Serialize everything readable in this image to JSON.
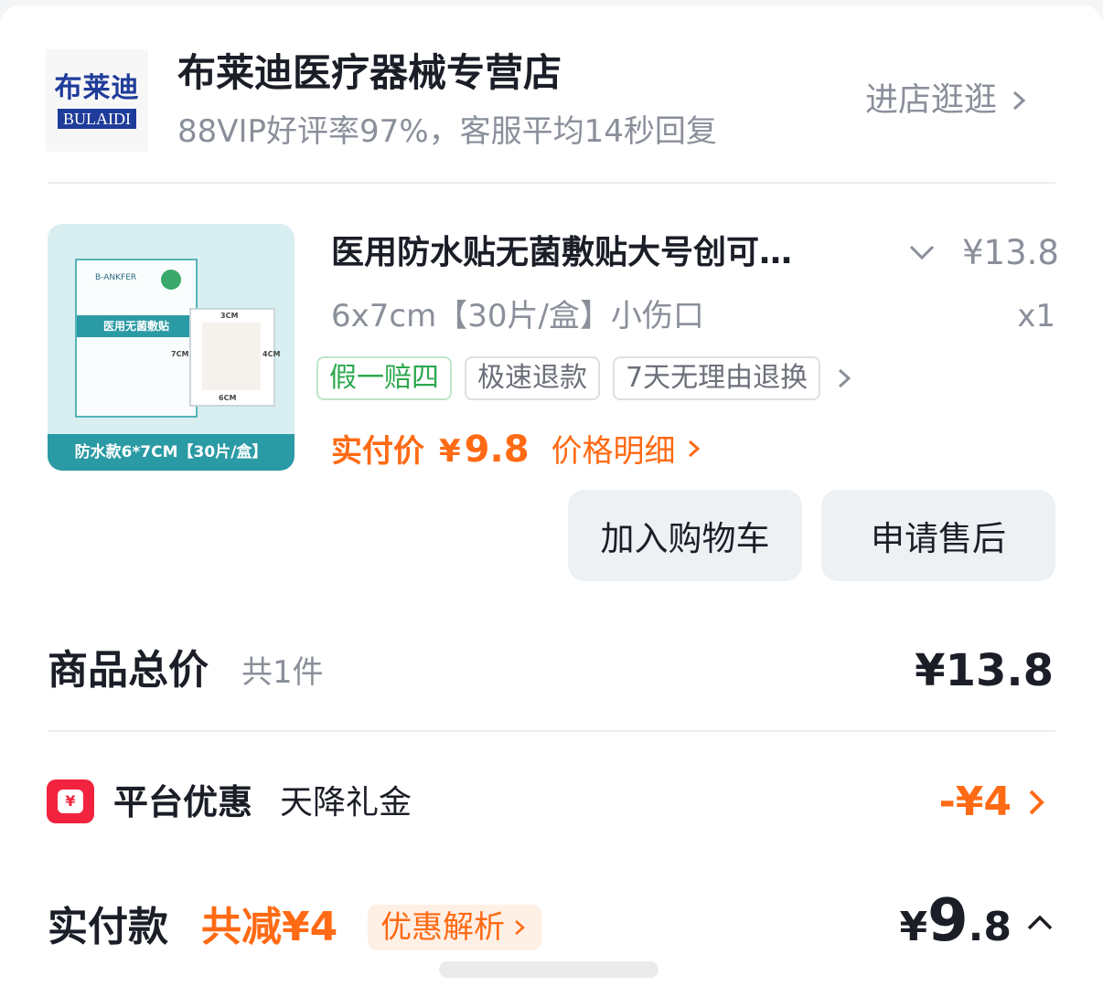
{
  "store": {
    "logo_cn": "布莱迪",
    "logo_en": "BULAIDI",
    "name": "布莱迪医疗器械专营店",
    "subtitle": "88VIP好评率97%，客服平均14秒回复",
    "enter_label": "进店逛逛"
  },
  "product": {
    "image": {
      "box_brand": "B-ANKFER",
      "box_band": "医用无菌敷贴",
      "dim_top": "3CM",
      "dim_side": "4CM",
      "dim_left": "7CM",
      "dim_bottom": "6CM",
      "footer": "防水款6*7CM【30片/盒】"
    },
    "title": "医用防水贴无菌敷贴大号创可…",
    "price": "¥13.8",
    "spec": "6x7cm【30片/盒】小伤口",
    "qty": "x1",
    "tags": [
      "假一赔四",
      "极速退款",
      "7天无理由退换"
    ],
    "paid_label": "实付价",
    "paid_yen": "¥",
    "paid_value": "9.8",
    "price_detail_label": "价格明细"
  },
  "actions": {
    "add_cart": "加入购物车",
    "after_sale": "申请售后"
  },
  "summary": {
    "total_label": "商品总价",
    "total_count": "共1件",
    "total_value": "¥13.8",
    "promo_label": "平台优惠",
    "promo_sub": "天降礼金",
    "promo_value": "-¥4",
    "pay_label": "实付款",
    "pay_reduce": "共减¥4",
    "pay_analysis": "优惠解析",
    "pay_yen": "¥",
    "pay_int": "9",
    "pay_dec": ".8"
  },
  "colors": {
    "accent_orange": "#ff6a14",
    "promo_red": "#f2233e",
    "tag_green": "#2da84f",
    "muted_text": "#8a8f9a"
  },
  "icons": [
    "chevron-right-icon",
    "chevron-down-icon",
    "chevron-up-icon",
    "red-packet-icon"
  ]
}
